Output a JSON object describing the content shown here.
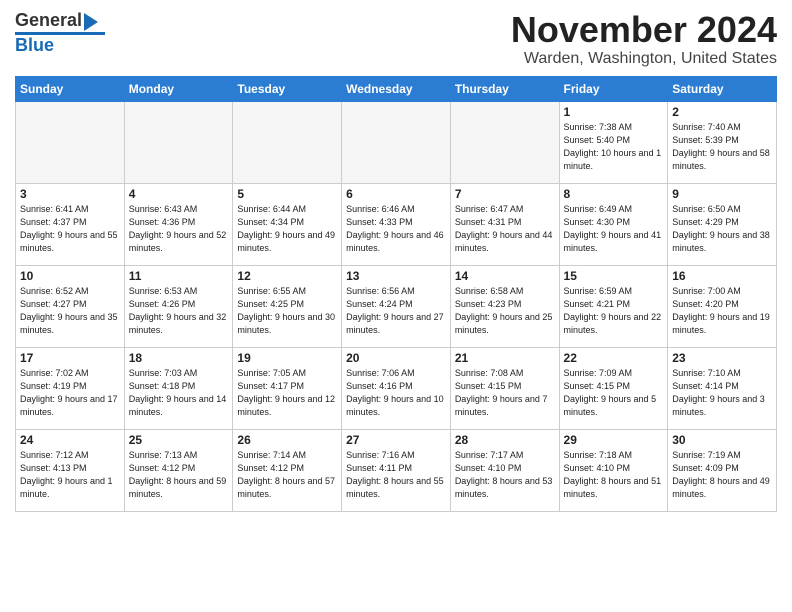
{
  "header": {
    "logo_general": "General",
    "logo_blue": "Blue",
    "month_title": "November 2024",
    "location": "Warden, Washington, United States"
  },
  "calendar": {
    "days_of_week": [
      "Sunday",
      "Monday",
      "Tuesday",
      "Wednesday",
      "Thursday",
      "Friday",
      "Saturday"
    ],
    "weeks": [
      [
        {
          "day": "",
          "info": ""
        },
        {
          "day": "",
          "info": ""
        },
        {
          "day": "",
          "info": ""
        },
        {
          "day": "",
          "info": ""
        },
        {
          "day": "",
          "info": ""
        },
        {
          "day": "1",
          "info": "Sunrise: 7:38 AM\nSunset: 5:40 PM\nDaylight: 10 hours and 1 minute."
        },
        {
          "day": "2",
          "info": "Sunrise: 7:40 AM\nSunset: 5:39 PM\nDaylight: 9 hours and 58 minutes."
        }
      ],
      [
        {
          "day": "3",
          "info": "Sunrise: 6:41 AM\nSunset: 4:37 PM\nDaylight: 9 hours and 55 minutes."
        },
        {
          "day": "4",
          "info": "Sunrise: 6:43 AM\nSunset: 4:36 PM\nDaylight: 9 hours and 52 minutes."
        },
        {
          "day": "5",
          "info": "Sunrise: 6:44 AM\nSunset: 4:34 PM\nDaylight: 9 hours and 49 minutes."
        },
        {
          "day": "6",
          "info": "Sunrise: 6:46 AM\nSunset: 4:33 PM\nDaylight: 9 hours and 46 minutes."
        },
        {
          "day": "7",
          "info": "Sunrise: 6:47 AM\nSunset: 4:31 PM\nDaylight: 9 hours and 44 minutes."
        },
        {
          "day": "8",
          "info": "Sunrise: 6:49 AM\nSunset: 4:30 PM\nDaylight: 9 hours and 41 minutes."
        },
        {
          "day": "9",
          "info": "Sunrise: 6:50 AM\nSunset: 4:29 PM\nDaylight: 9 hours and 38 minutes."
        }
      ],
      [
        {
          "day": "10",
          "info": "Sunrise: 6:52 AM\nSunset: 4:27 PM\nDaylight: 9 hours and 35 minutes."
        },
        {
          "day": "11",
          "info": "Sunrise: 6:53 AM\nSunset: 4:26 PM\nDaylight: 9 hours and 32 minutes."
        },
        {
          "day": "12",
          "info": "Sunrise: 6:55 AM\nSunset: 4:25 PM\nDaylight: 9 hours and 30 minutes."
        },
        {
          "day": "13",
          "info": "Sunrise: 6:56 AM\nSunset: 4:24 PM\nDaylight: 9 hours and 27 minutes."
        },
        {
          "day": "14",
          "info": "Sunrise: 6:58 AM\nSunset: 4:23 PM\nDaylight: 9 hours and 25 minutes."
        },
        {
          "day": "15",
          "info": "Sunrise: 6:59 AM\nSunset: 4:21 PM\nDaylight: 9 hours and 22 minutes."
        },
        {
          "day": "16",
          "info": "Sunrise: 7:00 AM\nSunset: 4:20 PM\nDaylight: 9 hours and 19 minutes."
        }
      ],
      [
        {
          "day": "17",
          "info": "Sunrise: 7:02 AM\nSunset: 4:19 PM\nDaylight: 9 hours and 17 minutes."
        },
        {
          "day": "18",
          "info": "Sunrise: 7:03 AM\nSunset: 4:18 PM\nDaylight: 9 hours and 14 minutes."
        },
        {
          "day": "19",
          "info": "Sunrise: 7:05 AM\nSunset: 4:17 PM\nDaylight: 9 hours and 12 minutes."
        },
        {
          "day": "20",
          "info": "Sunrise: 7:06 AM\nSunset: 4:16 PM\nDaylight: 9 hours and 10 minutes."
        },
        {
          "day": "21",
          "info": "Sunrise: 7:08 AM\nSunset: 4:15 PM\nDaylight: 9 hours and 7 minutes."
        },
        {
          "day": "22",
          "info": "Sunrise: 7:09 AM\nSunset: 4:15 PM\nDaylight: 9 hours and 5 minutes."
        },
        {
          "day": "23",
          "info": "Sunrise: 7:10 AM\nSunset: 4:14 PM\nDaylight: 9 hours and 3 minutes."
        }
      ],
      [
        {
          "day": "24",
          "info": "Sunrise: 7:12 AM\nSunset: 4:13 PM\nDaylight: 9 hours and 1 minute."
        },
        {
          "day": "25",
          "info": "Sunrise: 7:13 AM\nSunset: 4:12 PM\nDaylight: 8 hours and 59 minutes."
        },
        {
          "day": "26",
          "info": "Sunrise: 7:14 AM\nSunset: 4:12 PM\nDaylight: 8 hours and 57 minutes."
        },
        {
          "day": "27",
          "info": "Sunrise: 7:16 AM\nSunset: 4:11 PM\nDaylight: 8 hours and 55 minutes."
        },
        {
          "day": "28",
          "info": "Sunrise: 7:17 AM\nSunset: 4:10 PM\nDaylight: 8 hours and 53 minutes."
        },
        {
          "day": "29",
          "info": "Sunrise: 7:18 AM\nSunset: 4:10 PM\nDaylight: 8 hours and 51 minutes."
        },
        {
          "day": "30",
          "info": "Sunrise: 7:19 AM\nSunset: 4:09 PM\nDaylight: 8 hours and 49 minutes."
        }
      ]
    ]
  }
}
